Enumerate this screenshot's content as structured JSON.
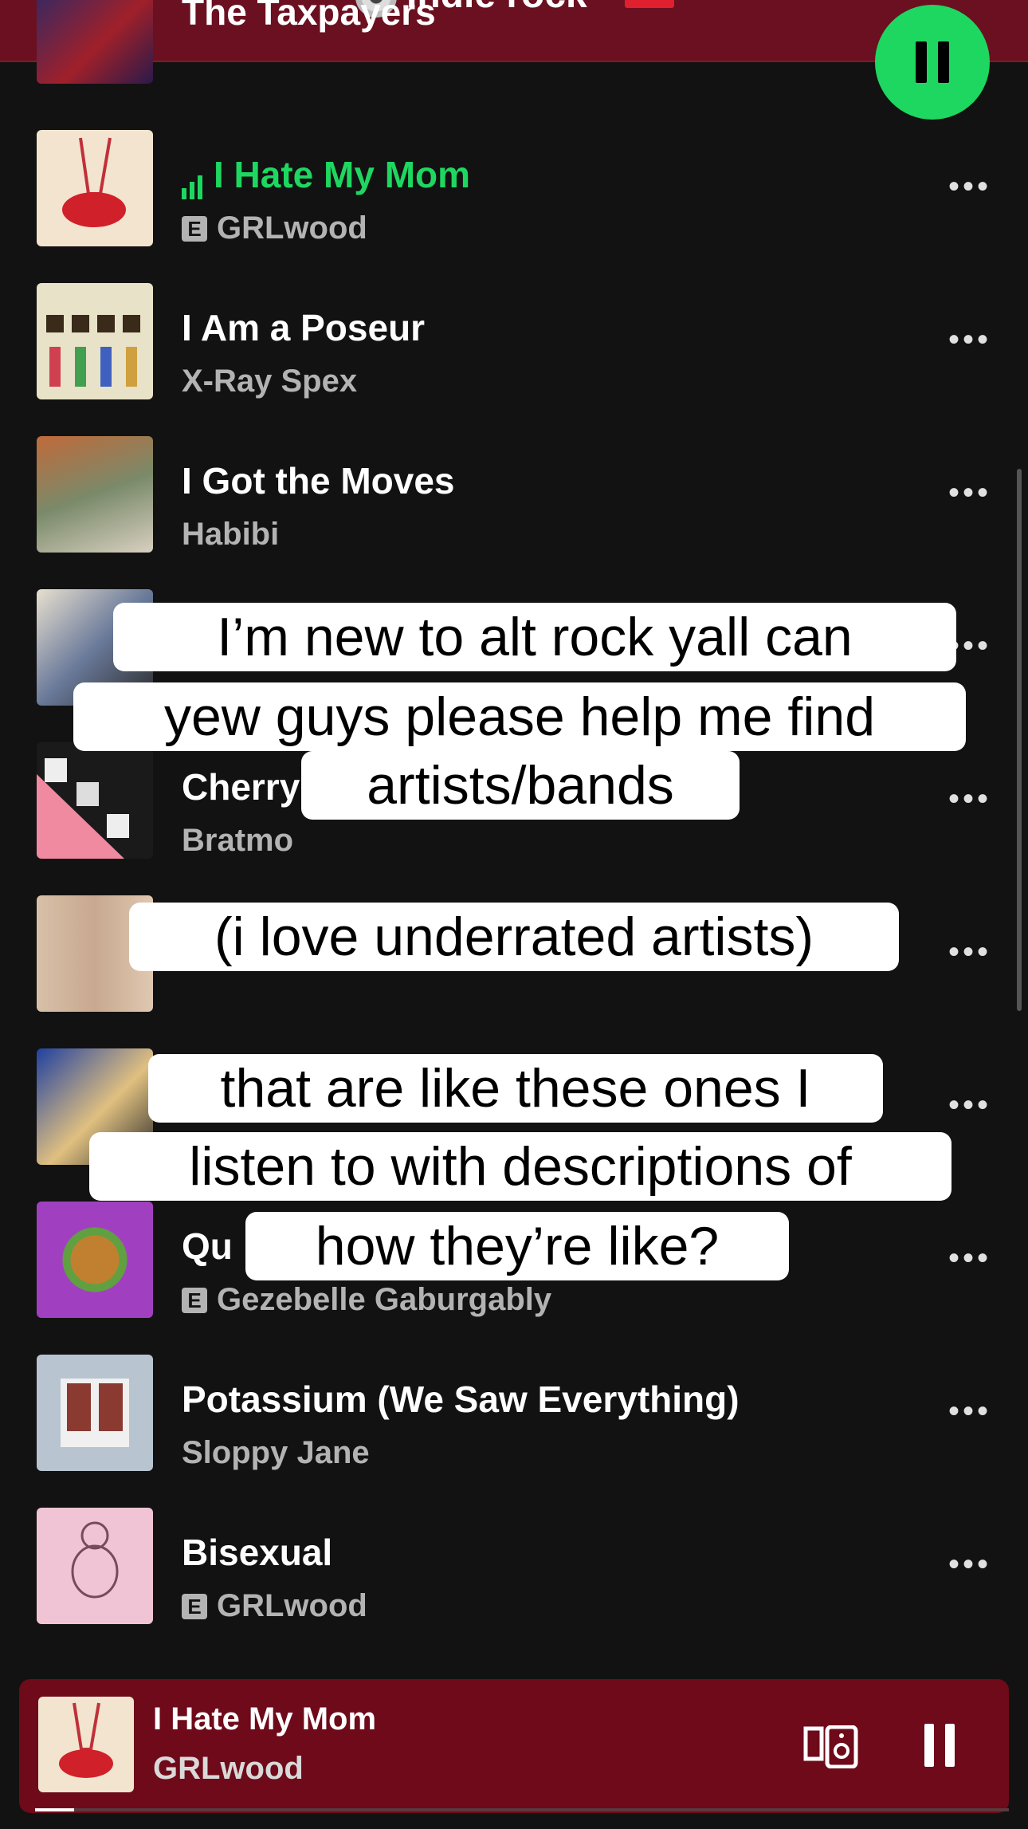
{
  "header": {
    "playlist_title": "Indie rock"
  },
  "tracks": [
    {
      "title": "The Taxpayers",
      "artist": "",
      "explicit": false
    },
    {
      "title": "I Hate My Mom",
      "artist": "GRLwood",
      "explicit": true,
      "playing": true
    },
    {
      "title": "I Am a Poseur",
      "artist": "X-Ray Spex",
      "explicit": false
    },
    {
      "title": "I Got the Moves",
      "artist": "Habibi",
      "explicit": false
    },
    {
      "title": "",
      "artist": "",
      "explicit": false
    },
    {
      "title": "Cherry",
      "artist": "Bratmo",
      "explicit": false
    },
    {
      "title": "",
      "artist": "",
      "explicit": false
    },
    {
      "title": "",
      "artist": "",
      "explicit": false
    },
    {
      "title": "Qu",
      "artist": "Gezebelle Gaburgably",
      "explicit": true
    },
    {
      "title": "Potassium (We Saw Everything)",
      "artist": "Sloppy Jane",
      "explicit": false
    },
    {
      "title": "Bisexual",
      "artist": "GRLwood",
      "explicit": true
    }
  ],
  "overlay": {
    "line1": "I’m new to alt rock yall can",
    "line2": "yew guys please help me find",
    "line3": "artists/bands",
    "line4": "(i love underrated artists)",
    "line5": "that are like these ones I",
    "line6": "listen to with descriptions of",
    "line7": "how they’re like?"
  },
  "mini_player": {
    "title": "I Hate My Mom",
    "artist": "GRLwood",
    "progress": 0.04
  },
  "explicit_badge": "E",
  "more_glyph": "•••",
  "colors": {
    "accent": "#1ed760",
    "header_bg": "#6b1020",
    "mini_bg": "#6e0a1a"
  }
}
